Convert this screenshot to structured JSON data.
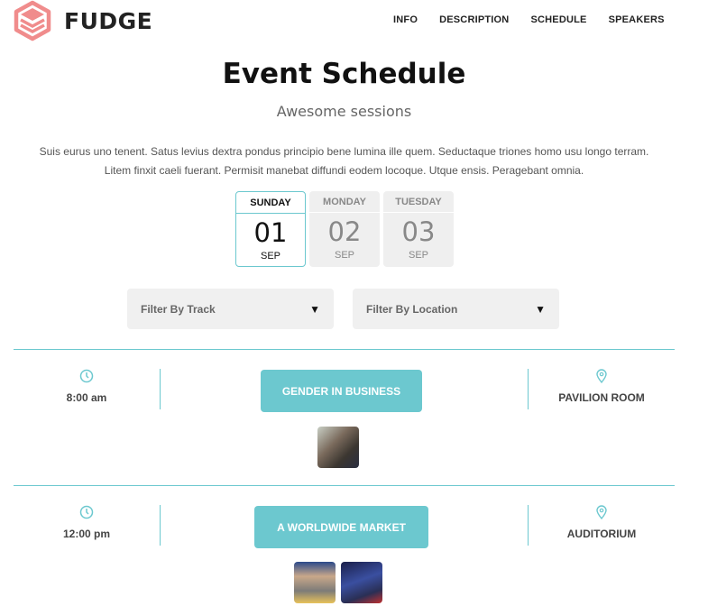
{
  "brand": {
    "name": "FUDGE",
    "logo_color": "#f08c8c"
  },
  "nav": [
    "INFO",
    "DESCRIPTION",
    "SCHEDULE",
    "SPEAKERS"
  ],
  "title": "Event Schedule",
  "subtitle": "Awesome sessions",
  "description": [
    "Suis eurus uno tenent. Satus levius dextra pondus principio bene lumina ille quem. Seductaque triones homo usu longo terram.",
    "Litem finxit caeli fuerant. Permisit manebat diffundi eodem locoque. Utque ensis. Peragebant omnia."
  ],
  "days": [
    {
      "name": "SUNDAY",
      "num": "01",
      "month": "SEP",
      "active": true
    },
    {
      "name": "MONDAY",
      "num": "02",
      "month": "SEP",
      "active": false
    },
    {
      "name": "TUESDAY",
      "num": "03",
      "month": "SEP",
      "active": false
    }
  ],
  "filters": {
    "track": "Filter By Track",
    "location": "Filter By Location",
    "arrow": "▼"
  },
  "accent": "#6cc8cf",
  "sessions": [
    {
      "time": "8:00 am",
      "title": "GENDER IN BUSINESS",
      "location": "PAVILION ROOM",
      "speakers": [
        "speaker-1"
      ]
    },
    {
      "time": "12:00 pm",
      "title": "A WORLDWIDE MARKET",
      "location": "AUDITORIUM",
      "speakers": [
        "speaker-2",
        "speaker-3"
      ]
    }
  ]
}
